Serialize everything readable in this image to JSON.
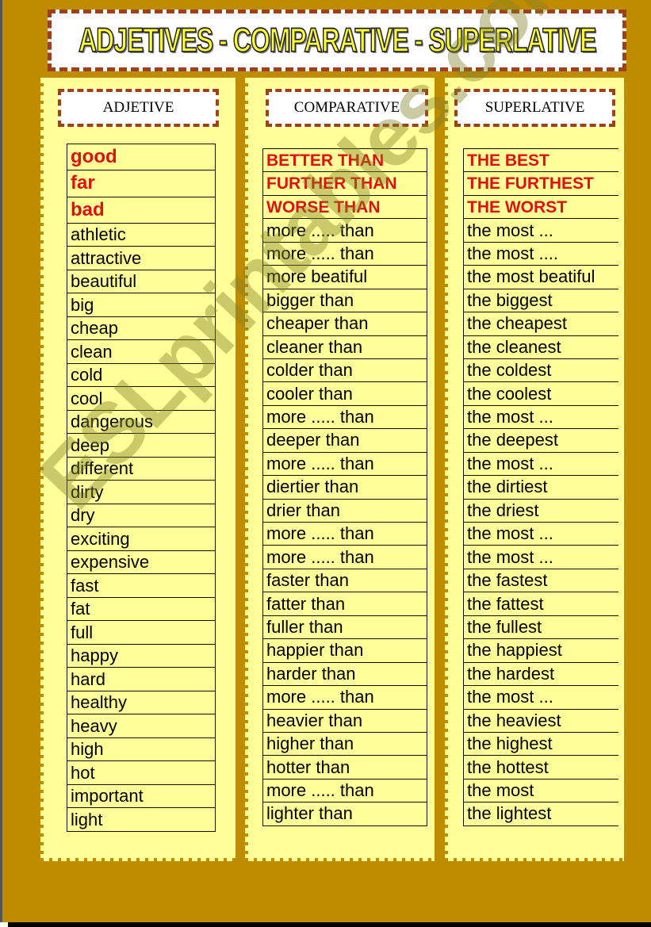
{
  "title": "ADJETIVES - COMPARATIVE - SUPERLATIVE",
  "watermark": "ESLprintables.com",
  "colors": {
    "background": "#BF8C00",
    "panel": "#FFFF99",
    "dash_border": "#A0401A",
    "highlight_text": "#E01010",
    "title_fill": "#FFFF33"
  },
  "columns": {
    "adjective": {
      "header": "ADJETIVE",
      "items": [
        "good",
        "far",
        "bad",
        "athletic",
        "attractive",
        "beautiful",
        "big",
        "cheap",
        "clean",
        "cold",
        "cool",
        "dangerous",
        "deep",
        "different",
        "dirty",
        "dry",
        "exciting",
        "expensive",
        "fast",
        "fat",
        "full",
        "happy",
        "hard",
        "healthy",
        "heavy",
        "high",
        "hot",
        "important",
        "light"
      ]
    },
    "comparative": {
      "header": "COMPARATIVE",
      "items": [
        "BETTER THAN",
        "FURTHER THAN",
        "WORSE THAN",
        "more ..... than",
        "more ..... than",
        "more beatiful",
        "bigger than",
        "cheaper than",
        "cleaner than",
        "colder than",
        "cooler than",
        "more ..... than",
        "deeper than",
        "more ..... than",
        "diertier than",
        "drier than",
        "more ..... than",
        "more ..... than",
        "faster than",
        "fatter than",
        "fuller than",
        "happier than",
        "harder than",
        "more ..... than",
        "heavier than",
        "higher than",
        "hotter than",
        "more ..... than",
        "lighter than"
      ]
    },
    "superlative": {
      "header": "SUPERLATIVE",
      "items": [
        "THE BEST",
        "THE FURTHEST",
        "THE WORST",
        "the most ...",
        "the most ....",
        "the most beatiful",
        "the biggest",
        "the cheapest",
        "the cleanest",
        "the coldest",
        "the coolest",
        "the  most ...",
        "the deepest",
        "the  most ...",
        "the dirtiest",
        "the driest",
        "the  most ...",
        "the  most ...",
        "the fastest",
        "the fattest",
        "the fullest",
        "the happiest",
        "the hardest",
        "the  most ...",
        "the  heaviest",
        "the highest",
        "the hottest",
        "the most",
        "the lightest"
      ]
    },
    "highlighted_count": 3
  }
}
